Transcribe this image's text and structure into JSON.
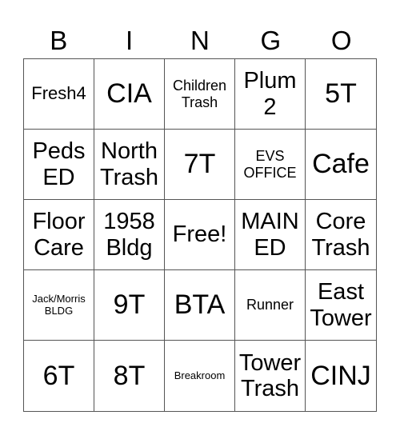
{
  "header": {
    "letters": [
      "B",
      "I",
      "N",
      "G",
      "O"
    ]
  },
  "cells": [
    {
      "text": "Fresh4",
      "size": "s-md"
    },
    {
      "text": "CIA",
      "size": "s-xl"
    },
    {
      "text": "Children\nTrash",
      "size": "s-sm"
    },
    {
      "text": "Plum\n2",
      "size": "s-lg"
    },
    {
      "text": "5T",
      "size": "s-xl"
    },
    {
      "text": "Peds\nED",
      "size": "s-lg"
    },
    {
      "text": "North\nTrash",
      "size": "s-lg"
    },
    {
      "text": "7T",
      "size": "s-xl"
    },
    {
      "text": "EVS\nOFFICE",
      "size": "s-sm"
    },
    {
      "text": "Cafe",
      "size": "s-xl"
    },
    {
      "text": "Floor\nCare",
      "size": "s-lg"
    },
    {
      "text": "1958\nBldg",
      "size": "s-lg"
    },
    {
      "text": "Free!",
      "size": "s-lg"
    },
    {
      "text": "MAIN\nED",
      "size": "s-lg"
    },
    {
      "text": "Core\nTrash",
      "size": "s-lg"
    },
    {
      "text": "Jack/Morris\nBLDG",
      "size": "s-xs"
    },
    {
      "text": "9T",
      "size": "s-xl"
    },
    {
      "text": "BTA",
      "size": "s-xl"
    },
    {
      "text": "Runner",
      "size": "s-sm"
    },
    {
      "text": "East\nTower",
      "size": "s-lg"
    },
    {
      "text": "6T",
      "size": "s-xl"
    },
    {
      "text": "8T",
      "size": "s-xl"
    },
    {
      "text": "Breakroom",
      "size": "s-xs"
    },
    {
      "text": "Tower\nTrash",
      "size": "s-lg"
    },
    {
      "text": "CINJ",
      "size": "s-xl"
    }
  ]
}
